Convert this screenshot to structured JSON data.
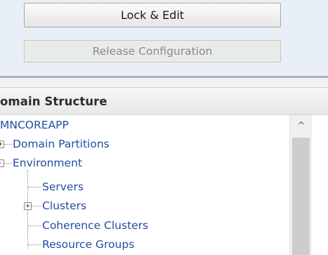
{
  "change_center": {
    "lock_edit_label": "Lock & Edit",
    "release_config_label": "Release Configuration"
  },
  "domain_structure": {
    "title": "omain Structure",
    "tree": {
      "root": "MNCOREAPP",
      "items": [
        {
          "label": "Domain Partitions",
          "expander": "+"
        },
        {
          "label": "Environment",
          "expander": "-"
        },
        {
          "label": "Servers"
        },
        {
          "label": "Clusters",
          "expander": "+"
        },
        {
          "label": "Coherence Clusters"
        },
        {
          "label": "Resource Groups"
        }
      ]
    }
  },
  "scrollbar": {
    "up_arrow": "^"
  }
}
